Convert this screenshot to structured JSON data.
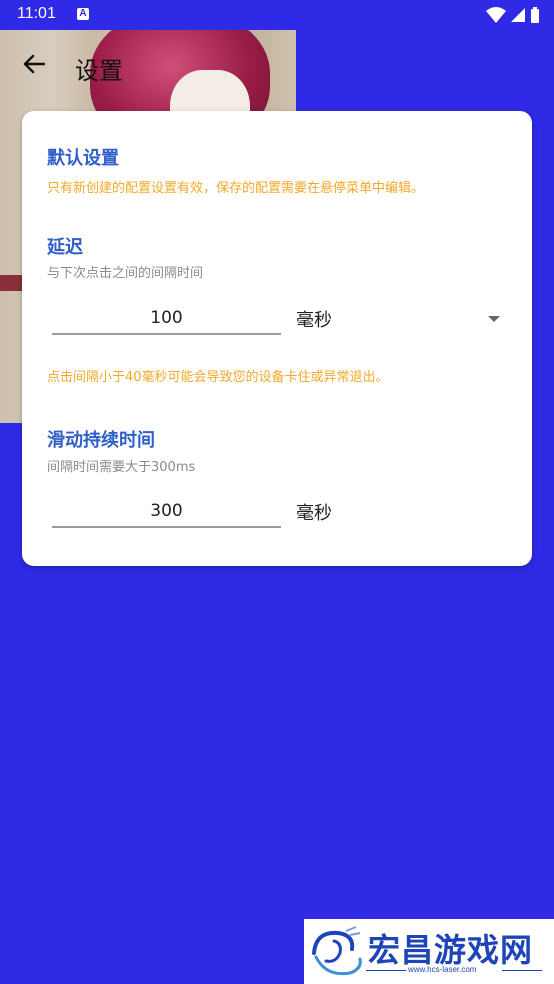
{
  "status_bar": {
    "time": "11:01",
    "notification_badge": "A"
  },
  "app_bar": {
    "title": "设置"
  },
  "card": {
    "defaults": {
      "title": "默认设置",
      "note": "只有新创建的配置设置有效，保存的配置需要在悬停菜单中编辑。"
    },
    "delay": {
      "title": "延迟",
      "description": "与下次点击之间的间隔时间",
      "value": "100",
      "unit": "毫秒",
      "warning": "点击间隔小于40毫秒可能会导致您的设备卡住或异常退出。"
    },
    "swipe_duration": {
      "title": "滑动持续时间",
      "description": "间隔时间需要大于300ms",
      "value": "300",
      "unit": "毫秒"
    }
  },
  "watermark": {
    "brand": "宏昌游戏网",
    "url": "www.hcs-laser.com"
  },
  "colors": {
    "background": "#2e2ae6",
    "accent_title": "#2f5fc8",
    "warning": "#f4a92a"
  }
}
